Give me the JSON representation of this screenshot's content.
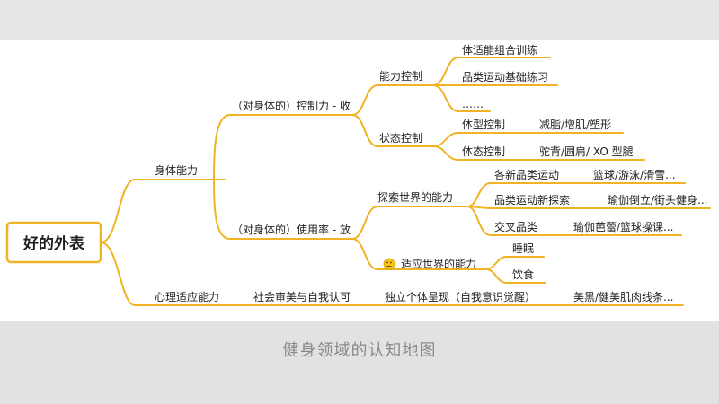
{
  "caption": "健身领域的认知地图",
  "colors": {
    "branch": "#f0b323",
    "root_border": "#f0b323",
    "text": "#222222"
  },
  "nodes": {
    "root": "好的外表",
    "body": "身体能力",
    "control": "（对身体的）控制力 - 收",
    "ability_control": "能力控制",
    "combo_training": "体适能组合训练",
    "basic_practice": "品类运动基础练习",
    "ellipsis": "……",
    "state_control": "状态控制",
    "shape_control": "体型控制",
    "shape_detail": "减脂/增肌/塑形",
    "posture_control": "体态控制",
    "posture_detail": "驼背/圆肩/ XO 型腿",
    "usage": "（对身体的）使用率 - 放",
    "explore": "探索世界的能力",
    "new_sports": "各新品类运动",
    "new_sports_detail": "篮球/游泳/滑雪...",
    "new_explore": "品类运动新探索",
    "new_explore_detail": "瑜伽倒立/街头健身...",
    "cross": "交叉品类",
    "cross_detail": "瑜伽芭蕾/篮球操课...",
    "adapt": "适应世界的能力",
    "sleep": "睡眠",
    "diet": "饮食",
    "mental": "心理适应能力",
    "social": "社会审美与自我认可",
    "independent": "独立个体呈现（自我意识觉醒）",
    "independent_detail": "美黑/健美肌肉线条..."
  }
}
